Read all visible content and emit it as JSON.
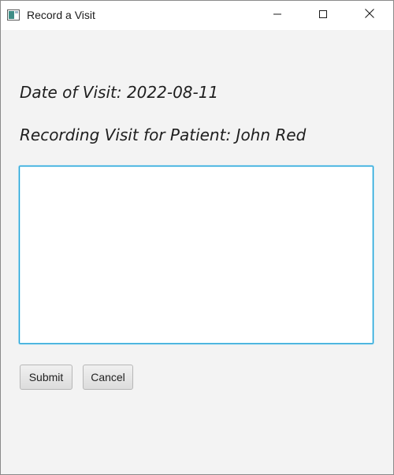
{
  "window": {
    "title": "Record a Visit",
    "controls": {
      "minimize": "minimize-icon",
      "maximize": "maximize-icon",
      "close": "close-icon"
    }
  },
  "form": {
    "date_label": "Date of Visit: 2022-08-11",
    "patient_label": "Recording Visit for Patient: John Red",
    "notes_value": "",
    "submit_label": "Submit",
    "cancel_label": "Cancel"
  },
  "colors": {
    "focus_border": "#1fa0d6",
    "background": "#f3f3f3"
  }
}
